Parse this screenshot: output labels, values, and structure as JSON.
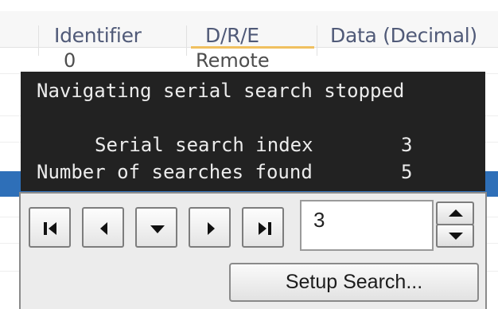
{
  "table": {
    "headers": [
      "Identifier",
      "D/R/E",
      "Data (Decimal)"
    ],
    "first_row": {
      "identifier": "0",
      "dre": "Remote"
    }
  },
  "status": {
    "title": "Navigating serial search stopped",
    "index_label": "Serial search index",
    "index_value": "3",
    "found_label": "Number of searches found",
    "found_value": "5"
  },
  "navigator": {
    "buttons": [
      "skip-first-icon",
      "previous-icon",
      "down-icon",
      "next-icon",
      "skip-last-icon"
    ],
    "value": "3",
    "spin_up_icon": "triangle-up-icon",
    "spin_down_icon": "triangle-down-icon",
    "setup_label": "Setup Search..."
  },
  "colors": {
    "status_background": "#222222",
    "selection": "#2e6fb8",
    "sort_indicator": "#f0c060"
  }
}
